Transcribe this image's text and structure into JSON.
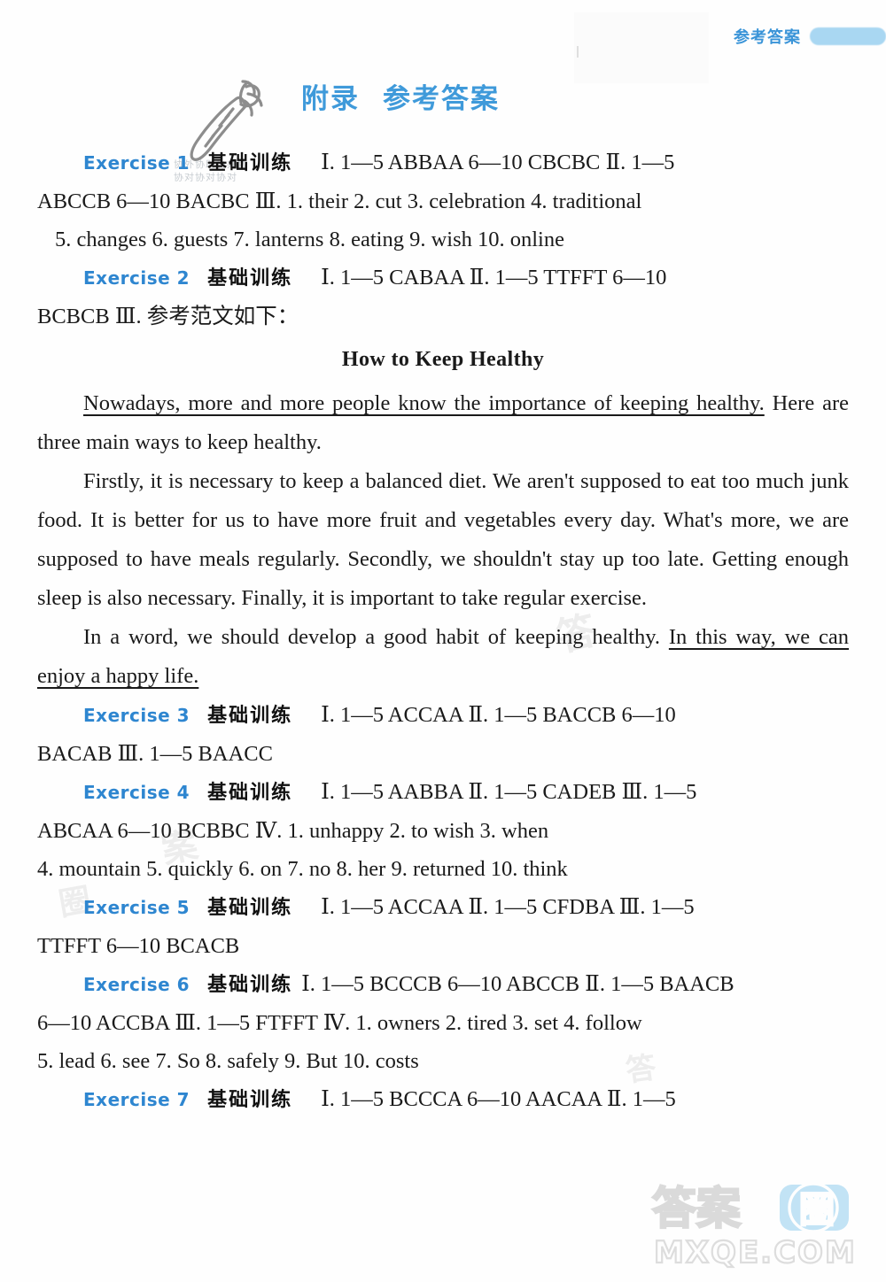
{
  "header": {
    "running_label": "参考答案",
    "accent_color": "#3a94d8",
    "bar_color": "#a9d7f2"
  },
  "title": {
    "part1": "附录",
    "part2": "参考答案"
  },
  "icons": {
    "carrot": "carrot-doodle-icon"
  },
  "ghost_text": {
    "line1": "协外协助协办协",
    "line2": "协对协对协对"
  },
  "exercises": [
    {
      "tag": "Exercise 1",
      "section": "基础训练",
      "lines": [
        "Ⅰ. 1—5 ABBAA   6—10 CBCBC   Ⅱ. 1—5",
        "ABCCB  6—10 BACBC   Ⅲ. 1. their  2. cut  3. celebration  4. traditional",
        "5. changes  6. guests  7. lanterns  8. eating  9. wish  10. online"
      ]
    },
    {
      "tag": "Exercise 2",
      "section": "基础训练",
      "lines": [
        "Ⅰ. 1—5 CABAA   Ⅱ. 1—5 TTFFT   6—10",
        "BCBCB   Ⅲ. 参考范文如下："
      ]
    },
    {
      "tag": "Exercise 3",
      "section": "基础训练",
      "lines": [
        "Ⅰ. 1—5 ACCAA   Ⅱ. 1—5 BACCB   6—10",
        "BACAB  Ⅲ. 1—5 BAACC"
      ]
    },
    {
      "tag": "Exercise 4",
      "section": "基础训练",
      "lines": [
        "Ⅰ. 1—5 AABBA   Ⅱ. 1—5 CADEB   Ⅲ. 1—5",
        "ABCAA   6—10 BCBBC   Ⅳ. 1. unhappy   2. to wish   3. when",
        "4. mountain  5. quickly  6. on  7. no  8. her  9. returned  10. think"
      ]
    },
    {
      "tag": "Exercise 5",
      "section": "基础训练",
      "lines": [
        "Ⅰ. 1—5 ACCAA   Ⅱ. 1—5 CFDBA   Ⅲ. 1—5",
        "TTFFT   6—10 BCACB"
      ]
    },
    {
      "tag": "Exercise 6",
      "section": "基础训练",
      "lines": [
        "Ⅰ. 1—5 BCCCB   6—10 ABCCB   Ⅱ. 1—5 BAACB",
        "6—10 ACCBA   Ⅲ. 1—5 FTFFT   Ⅳ. 1. owners  2. tired  3. set  4. follow",
        "5. lead  6. see  7. So  8. safely  9. But  10. costs"
      ]
    },
    {
      "tag": "Exercise 7",
      "section": "基础训练",
      "lines": [
        "Ⅰ. 1—5 BCCCA   6—10 AACAA   Ⅱ. 1—5"
      ]
    }
  ],
  "essay": {
    "title": "How to Keep Healthy",
    "p1_underlined": "Nowadays, more and more people know the importance of keeping healthy.",
    "p1_rest": " Here are three main ways to keep healthy.",
    "p2": "Firstly, it is necessary to keep a balanced diet.  We aren't supposed to eat too much junk food.  It is better for us to have more fruit and vegetables every day.  What's more, we are supposed to have meals regularly.  Secondly, we shouldn't stay up too late.  Getting enough sleep is also necessary.  Finally, it is important to take regular exercise.",
    "p3_plain": "In a word, we should develop a good habit of keeping healthy.  ",
    "p3_underlined": "In this way, we can enjoy a happy life."
  },
  "watermark": {
    "logo_text": "答案",
    "logo_badge": "圈",
    "site": "MXQE.COM",
    "faint_marks": [
      "答",
      "案",
      "圈",
      "答"
    ]
  }
}
